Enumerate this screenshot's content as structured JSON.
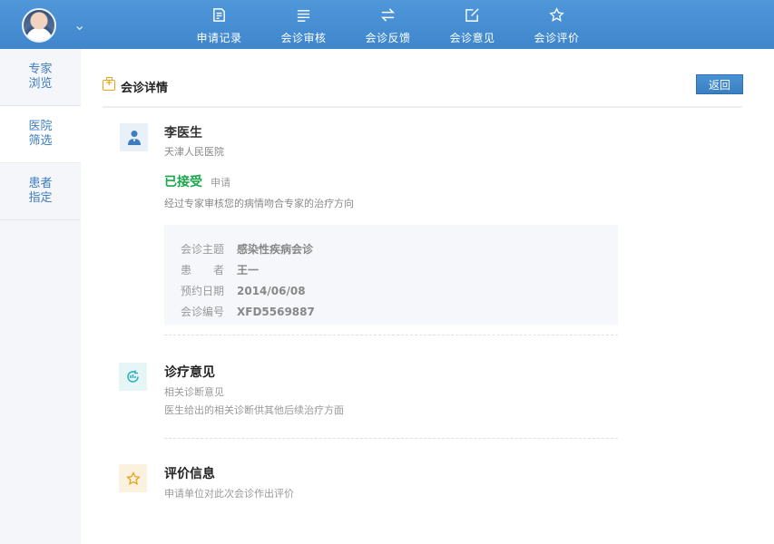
{
  "topbar": {
    "nav": [
      {
        "label": "申请记录",
        "icon": "document-edit-icon"
      },
      {
        "label": "会诊审核",
        "icon": "list-icon"
      },
      {
        "label": "会诊反馈",
        "icon": "exchange-arrows-icon"
      },
      {
        "label": "会诊意见",
        "icon": "edit-square-icon"
      },
      {
        "label": "会诊评价",
        "icon": "star-outline-icon"
      }
    ]
  },
  "sidebar": {
    "items": [
      {
        "label": "专家浏览"
      },
      {
        "label": "医院筛选"
      },
      {
        "label": "患者指定"
      }
    ]
  },
  "main": {
    "title": "会诊详情",
    "back_label": "返回",
    "doctor": {
      "name": "李医生",
      "hospital": "天津人民医院",
      "status": "已接受",
      "status_sub": "申请",
      "status_desc": "经过专家审核您的病情吻合专家的治疗方向"
    },
    "info": [
      {
        "key": "会诊主题",
        "value": "感染性疾病会诊"
      },
      {
        "key": "患　　者",
        "value": "王一"
      },
      {
        "key": "预约日期",
        "value": "2014/06/08"
      },
      {
        "key": "会诊编号",
        "value": "XFD5569887"
      }
    ],
    "diagnosis": {
      "title": "诊疗意见",
      "subtitle": "相关诊断意见",
      "desc": "医生给出的相关诊断供其他后续治疗方面"
    },
    "evaluation": {
      "title": "评价信息",
      "desc": "申请单位对此次会诊作出评价"
    }
  },
  "colors": {
    "topbar": "#4a91d5",
    "accent_blue": "#3d7cc0",
    "status_green": "#1aa84a",
    "header_icon": "#e9a319"
  }
}
